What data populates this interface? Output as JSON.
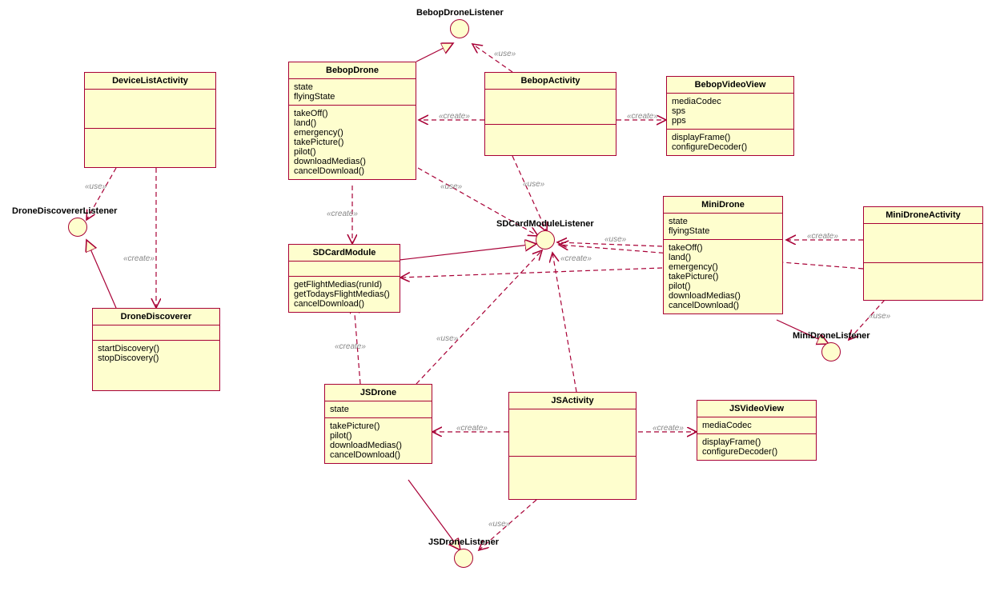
{
  "interfaces": {
    "bebopDroneListener": "BebopDroneListener",
    "droneDiscovererListener": "DroneDiscovererListener",
    "sdCardModuleListener": "SDCardModuleListener",
    "miniDroneListener": "MiniDroneListener",
    "jsDroneListener": "JSDroneListener"
  },
  "classes": {
    "deviceListActivity": {
      "name": "DeviceListActivity",
      "attrs": [],
      "methods": []
    },
    "bebopDrone": {
      "name": "BebopDrone",
      "attrs": [
        "state",
        "flyingState"
      ],
      "methods": [
        "takeOff()",
        "land()",
        "emergency()",
        "takePicture()",
        "pilot()",
        "downloadMedias()",
        "cancelDownload()"
      ]
    },
    "bebopActivity": {
      "name": "BebopActivity",
      "attrs": [],
      "methods": []
    },
    "bebopVideoView": {
      "name": "BebopVideoView",
      "attrs": [
        "mediaCodec",
        "sps",
        "pps"
      ],
      "methods": [
        "displayFrame()",
        "configureDecoder()"
      ]
    },
    "droneDiscoverer": {
      "name": "DroneDiscoverer",
      "attrs": [],
      "methods": [
        "startDiscovery()",
        "stopDiscovery()"
      ]
    },
    "sdCardModule": {
      "name": "SDCardModule",
      "attrs": [],
      "methods": [
        "getFlightMedias(runId)",
        "getTodaysFlightMedias()",
        "cancelDownload()"
      ]
    },
    "miniDrone": {
      "name": "MiniDrone",
      "attrs": [
        "state",
        "flyingState"
      ],
      "methods": [
        "takeOff()",
        "land()",
        "emergency()",
        "takePicture()",
        "pilot()",
        "downloadMedias()",
        "cancelDownload()"
      ]
    },
    "miniDroneActivity": {
      "name": "MiniDroneActivity",
      "attrs": [],
      "methods": []
    },
    "jsDrone": {
      "name": "JSDrone",
      "attrs": [
        "state"
      ],
      "methods": [
        "takePicture()",
        "pilot()",
        "downloadMedias()",
        "cancelDownload()"
      ]
    },
    "jsActivity": {
      "name": "JSActivity",
      "attrs": [],
      "methods": []
    },
    "jsVideoView": {
      "name": "JSVideoView",
      "attrs": [
        "mediaCodec"
      ],
      "methods": [
        "displayFrame()",
        "configureDecoder()"
      ]
    }
  },
  "stereotypes": {
    "use": "«use»",
    "create": "«create»"
  }
}
